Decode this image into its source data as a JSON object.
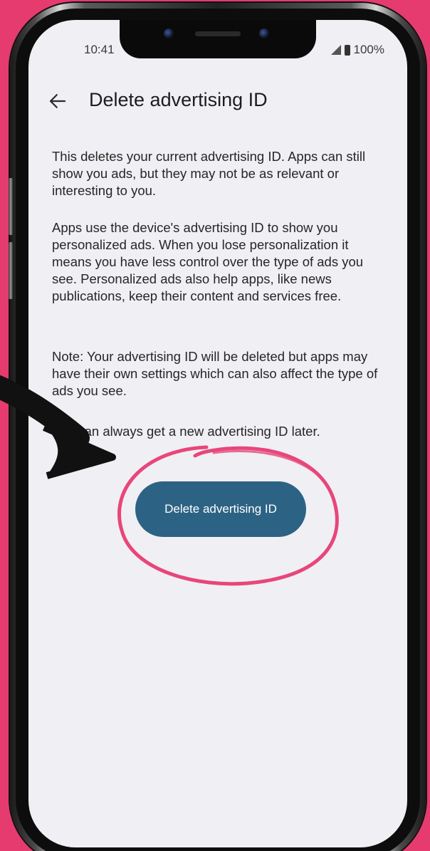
{
  "status_bar": {
    "time": "10:41",
    "battery": "100%",
    "signal_icon": "signal-icon",
    "battery_icon": "battery-icon"
  },
  "header": {
    "back_icon": "arrow-left-icon",
    "title": "Delete advertising ID"
  },
  "content": {
    "paragraph_1": "This deletes your current advertising ID. Apps can still show you ads, but they may not be as relevant or interesting to you.",
    "paragraph_2": "Apps use the device's advertising ID to show you personalized ads. When you lose personalization it means you have less control over the type of ads you see. Personalized ads also help apps, like news publications, keep their content and services free.",
    "paragraph_3": "Note: Your advertising ID will be deleted but apps may have their own settings which can also affect the type of ads you see.",
    "paragraph_4": "You can always get a new advertising ID later."
  },
  "action": {
    "button_label": "Delete advertising ID"
  },
  "colors": {
    "background": "#e63b6f",
    "button": "#2c6384",
    "annotation_circle": "#e8467a",
    "arrow": "#111111",
    "screen": "#f0f0f4"
  }
}
